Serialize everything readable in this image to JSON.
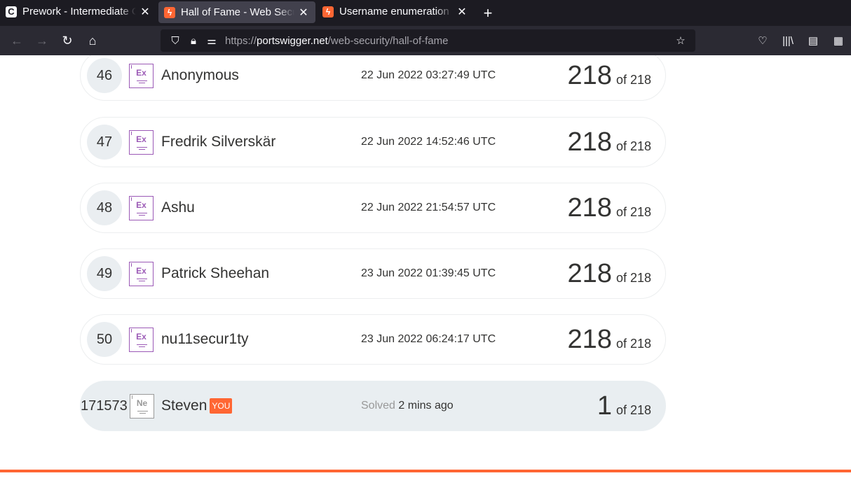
{
  "browser": {
    "tabs": [
      {
        "title": "Prework - Intermediate C",
        "icon": "c-favicon",
        "active": false
      },
      {
        "title": "Hall of Fame - Web Securi",
        "icon": "portswigger-favicon",
        "active": true
      },
      {
        "title": "Username enumeration v",
        "icon": "portswigger-favicon",
        "active": false
      }
    ],
    "new_tab": "+",
    "url": {
      "protocol": "https://",
      "host": "portswigger.net",
      "path": "/web-security/hall-of-fame"
    }
  },
  "leaderboard": {
    "rows": [
      {
        "rank": "46",
        "badge": "Ex",
        "name": "Anonymous",
        "date": "22 Jun 2022 03:27:49 UTC",
        "score": "218",
        "of": "of 218"
      },
      {
        "rank": "47",
        "badge": "Ex",
        "name": "Fredrik Silverskär",
        "date": "22 Jun 2022 14:52:46 UTC",
        "score": "218",
        "of": "of 218"
      },
      {
        "rank": "48",
        "badge": "Ex",
        "name": "Ashu",
        "date": "22 Jun 2022 21:54:57 UTC",
        "score": "218",
        "of": "of 218"
      },
      {
        "rank": "49",
        "badge": "Ex",
        "name": "Patrick Sheehan",
        "date": "23 Jun 2022 01:39:45 UTC",
        "score": "218",
        "of": "of 218"
      },
      {
        "rank": "50",
        "badge": "Ex",
        "name": "nu11secur1ty",
        "date": "23 Jun 2022 06:24:17 UTC",
        "score": "218",
        "of": "of 218"
      }
    ],
    "you": {
      "rank": "171573",
      "badge": "Ne",
      "name": "Steven",
      "you_tag": "YOU",
      "solved_label": "Solved",
      "solved_time": "2 mins ago",
      "score": "1",
      "of": "of 218"
    }
  },
  "colors": {
    "accent": "#ff6633",
    "expert_badge": "#9b59b6",
    "row_highlight": "#e9eef1"
  }
}
